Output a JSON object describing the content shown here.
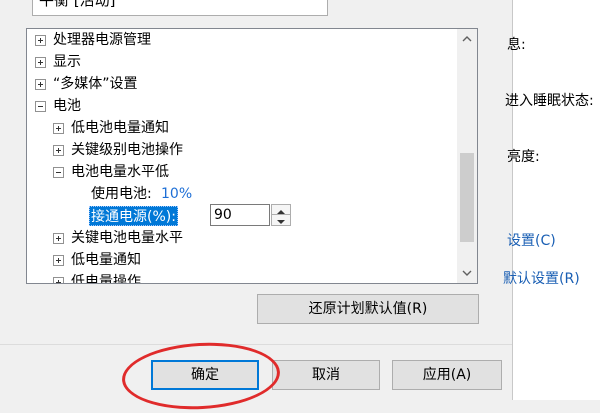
{
  "dropdown": {
    "value": "平衡 [活动]"
  },
  "tree": {
    "items": [
      {
        "label": "处理器电源管理",
        "expander": "plus"
      },
      {
        "label": "显示",
        "expander": "plus"
      },
      {
        "label": "“多媒体”设置",
        "expander": "plus"
      },
      {
        "label": "电池",
        "expander": "minus"
      },
      {
        "label": "低电池电量通知",
        "expander": "plus"
      },
      {
        "label": "关键级别电池操作",
        "expander": "plus"
      },
      {
        "label": "电池电量水平低",
        "expander": "minus"
      },
      {
        "label": "关键电池电量水平",
        "expander": "plus"
      },
      {
        "label": "低电量通知",
        "expander": "plus"
      },
      {
        "label": "低电量操作",
        "expander": "plus"
      }
    ],
    "battery_setting": {
      "label": "使用电池:",
      "value": "10%"
    },
    "plugged_setting": {
      "label": "接通电源(%):",
      "value": "90"
    }
  },
  "buttons": {
    "restore": "还原计划默认值(R)",
    "ok": "确定",
    "cancel": "取消",
    "apply": "应用(A)"
  },
  "right_strip": {
    "line1": "息:",
    "line2": "进入睡眠状态:",
    "line3": "亮度:",
    "link1": "设置(C)",
    "link2": "默认设置(R)"
  },
  "colors": {
    "accent": "#0078d7",
    "value_blue": "#1e6fd6",
    "annotation_red": "#e02b2b"
  }
}
